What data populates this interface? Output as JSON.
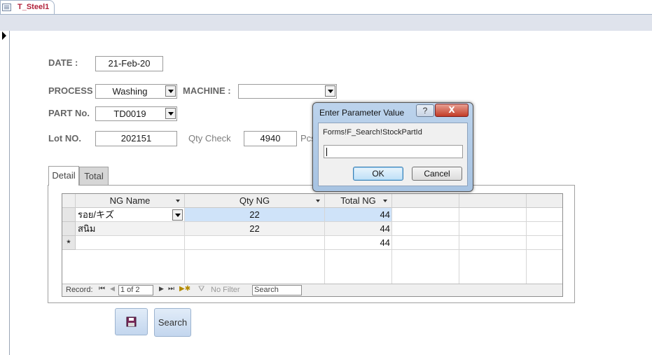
{
  "document_tab": {
    "title": "T_Steel1",
    "icon": "table-icon"
  },
  "form": {
    "date_label": "DATE :",
    "date_value": "21-Feb-20",
    "process_label": "PROCESS :",
    "process_value": "Washing",
    "machine_label": "MACHINE :",
    "machine_value": "",
    "part_label": "PART No.",
    "part_value": "TD0019",
    "lot_label": "Lot NO.",
    "lot_value": "202151",
    "qty_check_label": "Qty Check",
    "qty_check_value": "4940",
    "pcs_label": "Pcs"
  },
  "tabs": [
    {
      "label": "Detail",
      "active": true
    },
    {
      "label": "Total",
      "active": false
    }
  ],
  "datasheet": {
    "columns": [
      "NG Name",
      "Qty NG",
      "Total NG"
    ],
    "rows": [
      {
        "ng_name": "รอย/キズ",
        "qty_ng": "22",
        "total_ng": "44"
      },
      {
        "ng_name": "สนิม",
        "qty_ng": "22",
        "total_ng": "44"
      },
      {
        "ng_name": "",
        "qty_ng": "",
        "total_ng": "44"
      }
    ],
    "new_row_marker": "*",
    "nav": {
      "record_label": "Record:",
      "position": "1 of 2",
      "filter_label": "No Filter",
      "search_value": "Search"
    }
  },
  "buttons": {
    "save_icon": "save-icon",
    "search_label": "Search"
  },
  "dialog": {
    "title": "Enter Parameter Value",
    "help_label": "?",
    "close_label": "X",
    "prompt": "Forms!F_Search!StockPartId",
    "input_value": "",
    "ok_label": "OK",
    "cancel_label": "Cancel"
  },
  "colors": {
    "tab_title": "#b1223a",
    "selected_row": "#cfe3f9",
    "dialog_frame": "#a7c3e2",
    "close_button": "#c23b26"
  }
}
